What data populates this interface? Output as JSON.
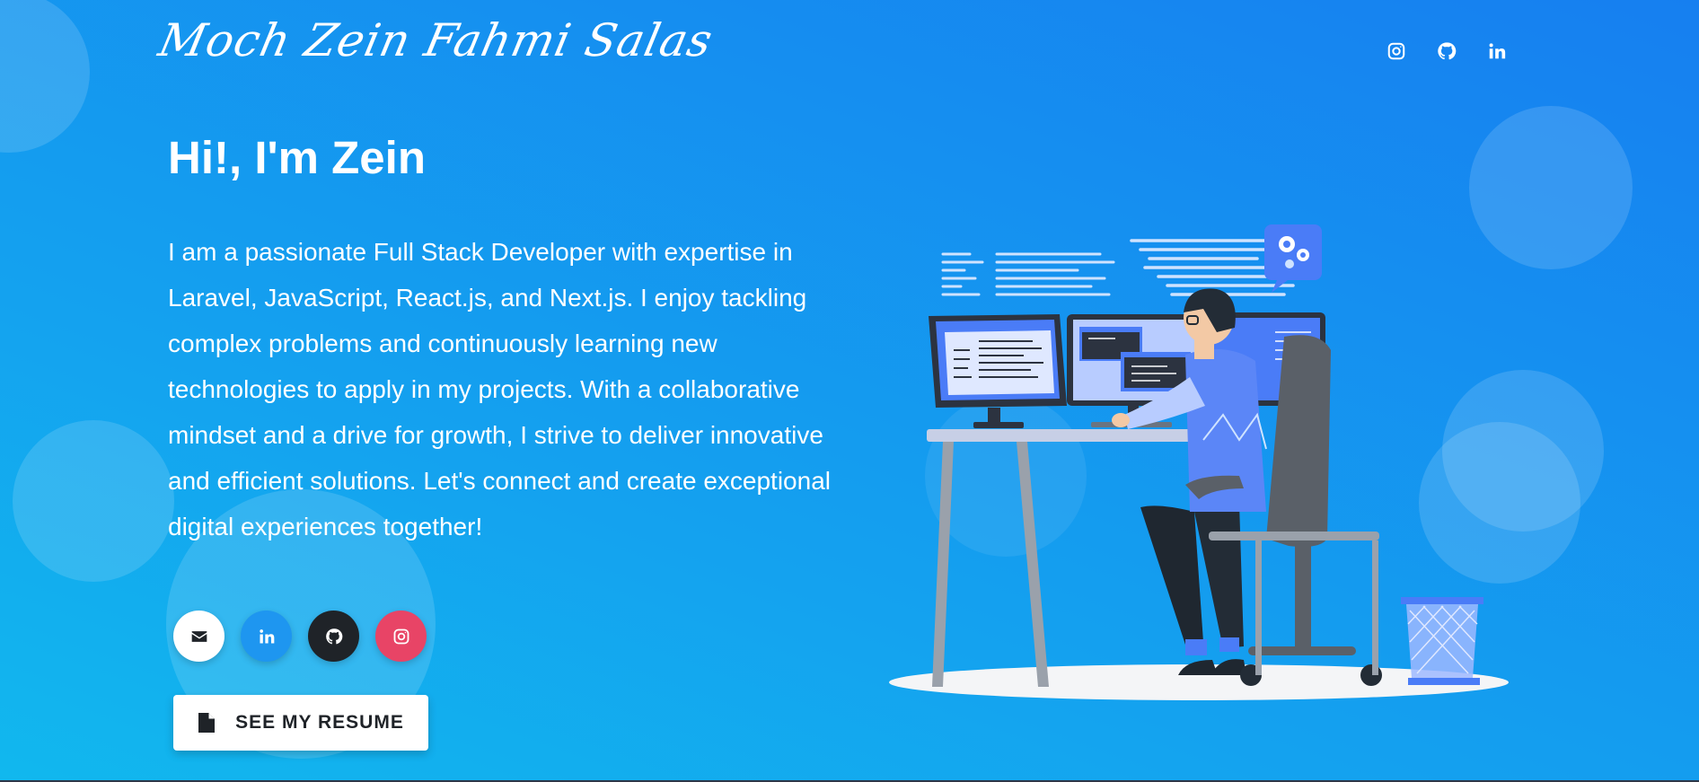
{
  "header": {
    "logo_text": "Moch Zein Fahmi Salas",
    "icons": [
      "instagram-icon",
      "github-icon",
      "linkedin-icon"
    ]
  },
  "hero": {
    "title": "Hi!, I'm Zein",
    "intro": "I am a passionate Full Stack Developer with expertise in Laravel, JavaScript, React.js, and Next.js. I enjoy tackling complex problems and continuously learning new technologies to apply in my projects. With a collaborative mindset and a drive for growth, I strive to deliver innovative and efficient solutions. Let's connect and create exceptional digital experiences together!"
  },
  "social_buttons": [
    {
      "icon": "email-icon",
      "bg": "#ffffff",
      "fg": "#1f2328"
    },
    {
      "icon": "linkedin-icon",
      "bg": "#1e96f0",
      "fg": "#ffffff"
    },
    {
      "icon": "github-icon",
      "bg": "#1f2328",
      "fg": "#ffffff"
    },
    {
      "icon": "instagram-icon",
      "bg": "#e84466",
      "fg": "#ffffff"
    }
  ],
  "resume_button": {
    "label": "SEE MY RESUME",
    "icon": "file-icon"
  },
  "colors": {
    "gradient_start": "#11b8ee",
    "gradient_end": "#167ff0",
    "accent_blue": "#4a7cf7"
  },
  "illustration": {
    "name": "developer-at-desk-illustration"
  }
}
